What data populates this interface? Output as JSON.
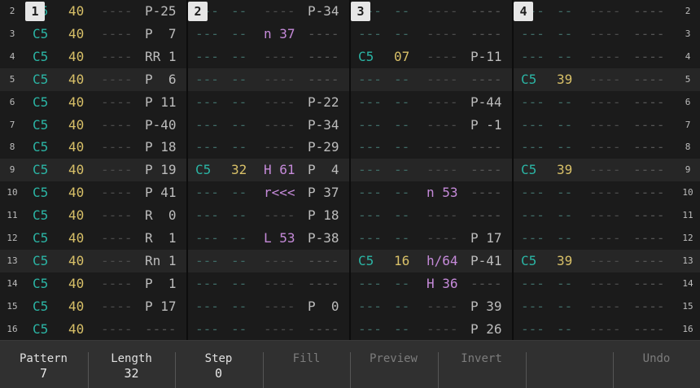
{
  "track_labels": [
    "1",
    "2",
    "3",
    "4"
  ],
  "row_numbers": [
    "2",
    "3",
    "4",
    "5",
    "6",
    "7",
    "8",
    "9",
    "10",
    "11",
    "12",
    "13",
    "14",
    "15",
    "16"
  ],
  "highlight_rows": [
    3,
    7,
    11
  ],
  "tracks": [
    {
      "rows": [
        [
          "C5",
          "40",
          "----",
          "P-25"
        ],
        [
          "C5",
          "40",
          "----",
          "P  7"
        ],
        [
          "C5",
          "40",
          "----",
          "RR 1"
        ],
        [
          "C5",
          "40",
          "----",
          "P  6"
        ],
        [
          "C5",
          "40",
          "----",
          "P 11"
        ],
        [
          "C5",
          "40",
          "----",
          "P-40"
        ],
        [
          "C5",
          "40",
          "----",
          "P 18"
        ],
        [
          "C5",
          "40",
          "----",
          "P 19"
        ],
        [
          "C5",
          "40",
          "----",
          "P 41"
        ],
        [
          "C5",
          "40",
          "----",
          "R  0"
        ],
        [
          "C5",
          "40",
          "----",
          "R  1"
        ],
        [
          "C5",
          "40",
          "----",
          "Rn 1"
        ],
        [
          "C5",
          "40",
          "----",
          "P  1"
        ],
        [
          "C5",
          "40",
          "----",
          "P 17"
        ],
        [
          "C5",
          "40",
          "----",
          "----"
        ]
      ]
    },
    {
      "rows": [
        [
          "---",
          "--",
          "----",
          "P-34"
        ],
        [
          "---",
          "--",
          "n 37",
          "----"
        ],
        [
          "---",
          "--",
          "----",
          "----"
        ],
        [
          "---",
          "--",
          "----",
          "----"
        ],
        [
          "---",
          "--",
          "----",
          "P-22"
        ],
        [
          "---",
          "--",
          "----",
          "P-34"
        ],
        [
          "---",
          "--",
          "----",
          "P-29"
        ],
        [
          "C5",
          "32",
          "H 61",
          "P  4"
        ],
        [
          "---",
          "--",
          "r<<<",
          "P 37"
        ],
        [
          "---",
          "--",
          "----",
          "P 18"
        ],
        [
          "---",
          "--",
          "L 53",
          "P-38"
        ],
        [
          "---",
          "--",
          "----",
          "----"
        ],
        [
          "---",
          "--",
          "----",
          "----"
        ],
        [
          "---",
          "--",
          "----",
          "P  0"
        ],
        [
          "---",
          "--",
          "----",
          "----"
        ]
      ]
    },
    {
      "rows": [
        [
          "---",
          "--",
          "----",
          "----"
        ],
        [
          "---",
          "--",
          "----",
          "----"
        ],
        [
          "C5",
          "07",
          "----",
          "P-11"
        ],
        [
          "---",
          "--",
          "----",
          "----"
        ],
        [
          "---",
          "--",
          "----",
          "P-44"
        ],
        [
          "---",
          "--",
          "----",
          "P -1"
        ],
        [
          "---",
          "--",
          "----",
          "----"
        ],
        [
          "---",
          "--",
          "----",
          "----"
        ],
        [
          "---",
          "--",
          "n 53",
          "----"
        ],
        [
          "---",
          "--",
          "----",
          "----"
        ],
        [
          "---",
          "--",
          "----",
          "P 17"
        ],
        [
          "C5",
          "16",
          "h/64",
          "P-41"
        ],
        [
          "---",
          "--",
          "H 36",
          "----"
        ],
        [
          "---",
          "--",
          "----",
          "P 39"
        ],
        [
          "---",
          "--",
          "----",
          "P 26"
        ]
      ]
    },
    {
      "rows": [
        [
          "---",
          "--",
          "----",
          "----"
        ],
        [
          "---",
          "--",
          "----",
          "----"
        ],
        [
          "---",
          "--",
          "----",
          "----"
        ],
        [
          "C5",
          "39",
          "----",
          "----"
        ],
        [
          "---",
          "--",
          "----",
          "----"
        ],
        [
          "---",
          "--",
          "----",
          "----"
        ],
        [
          "---",
          "--",
          "----",
          "----"
        ],
        [
          "C5",
          "39",
          "----",
          "----"
        ],
        [
          "---",
          "--",
          "----",
          "----"
        ],
        [
          "---",
          "--",
          "----",
          "----"
        ],
        [
          "---",
          "--",
          "----",
          "----"
        ],
        [
          "C5",
          "39",
          "----",
          "----"
        ],
        [
          "---",
          "--",
          "----",
          "----"
        ],
        [
          "---",
          "--",
          "----",
          "----"
        ],
        [
          "---",
          "--",
          "----",
          "----"
        ]
      ]
    }
  ],
  "bottom_bar": {
    "buttons": [
      {
        "name": "pattern-button",
        "label": "Pattern",
        "value": "7",
        "state": "active"
      },
      {
        "name": "length-button",
        "label": "Length",
        "value": "32",
        "state": "active"
      },
      {
        "name": "step-button",
        "label": "Step",
        "value": "0",
        "state": "active"
      },
      {
        "name": "fill-button",
        "label": "Fill",
        "value": "",
        "state": "dim"
      },
      {
        "name": "preview-button",
        "label": "Preview",
        "value": "",
        "state": "dim"
      },
      {
        "name": "invert-button",
        "label": "Invert",
        "value": "",
        "state": "dim"
      },
      {
        "name": "empty-button",
        "label": "",
        "value": "",
        "state": "dim"
      },
      {
        "name": "undo-button",
        "label": "Undo",
        "value": "",
        "state": "dim"
      }
    ]
  }
}
